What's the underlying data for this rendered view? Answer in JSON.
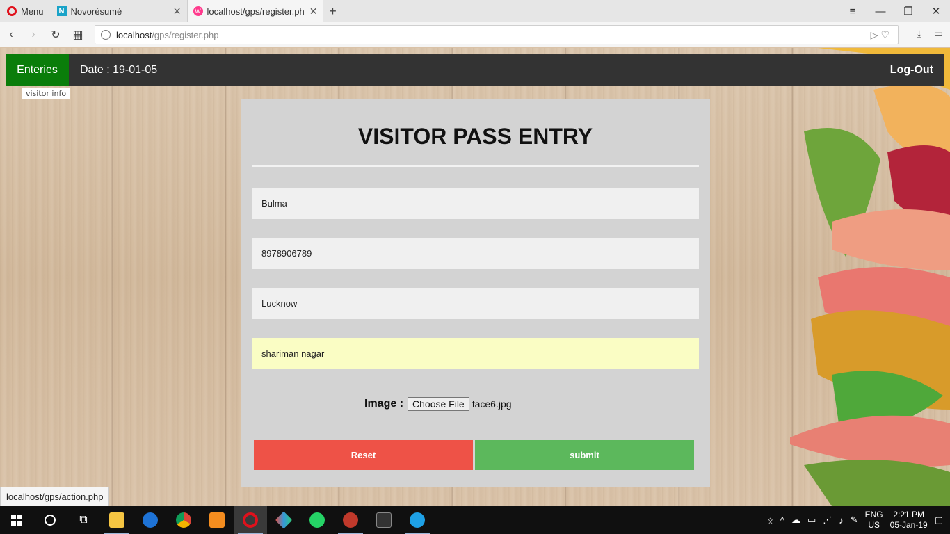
{
  "browser": {
    "menu_label": "Menu",
    "tabs": [
      {
        "title": "Novorésumé",
        "favicon": "N",
        "active": false
      },
      {
        "title": "localhost/gps/register.php",
        "favicon": "W",
        "active": true
      }
    ],
    "url_host": "localhost",
    "url_path": "/gps/register.php",
    "status_url": "localhost/gps/action.php"
  },
  "nav": {
    "entries_label": "Enteries",
    "date_text": "Date : 19-01-05",
    "logout_label": "Log-Out",
    "tooltip": "visitor info"
  },
  "form": {
    "title": "VISITOR PASS ENTRY",
    "name_value": "Bulma",
    "phone_value": "8978906789",
    "city_value": "Lucknow",
    "address_value": "shariman nagar",
    "image_label": "Image :",
    "choose_file_label": "Choose File",
    "file_name": "face6.jpg",
    "reset_label": "Reset",
    "submit_label": "submit"
  },
  "taskbar": {
    "lang_top": "ENG",
    "lang_bottom": "US",
    "time": "2:21 PM",
    "date": "05-Jan-19"
  },
  "colors": {
    "nav_bg": "#333333",
    "entries_bg": "#0a7d0a",
    "card_bg": "#d3d3d3",
    "reset_bg": "#ee5247",
    "submit_bg": "#5cb85c",
    "autofill_bg": "#fafdc4"
  }
}
